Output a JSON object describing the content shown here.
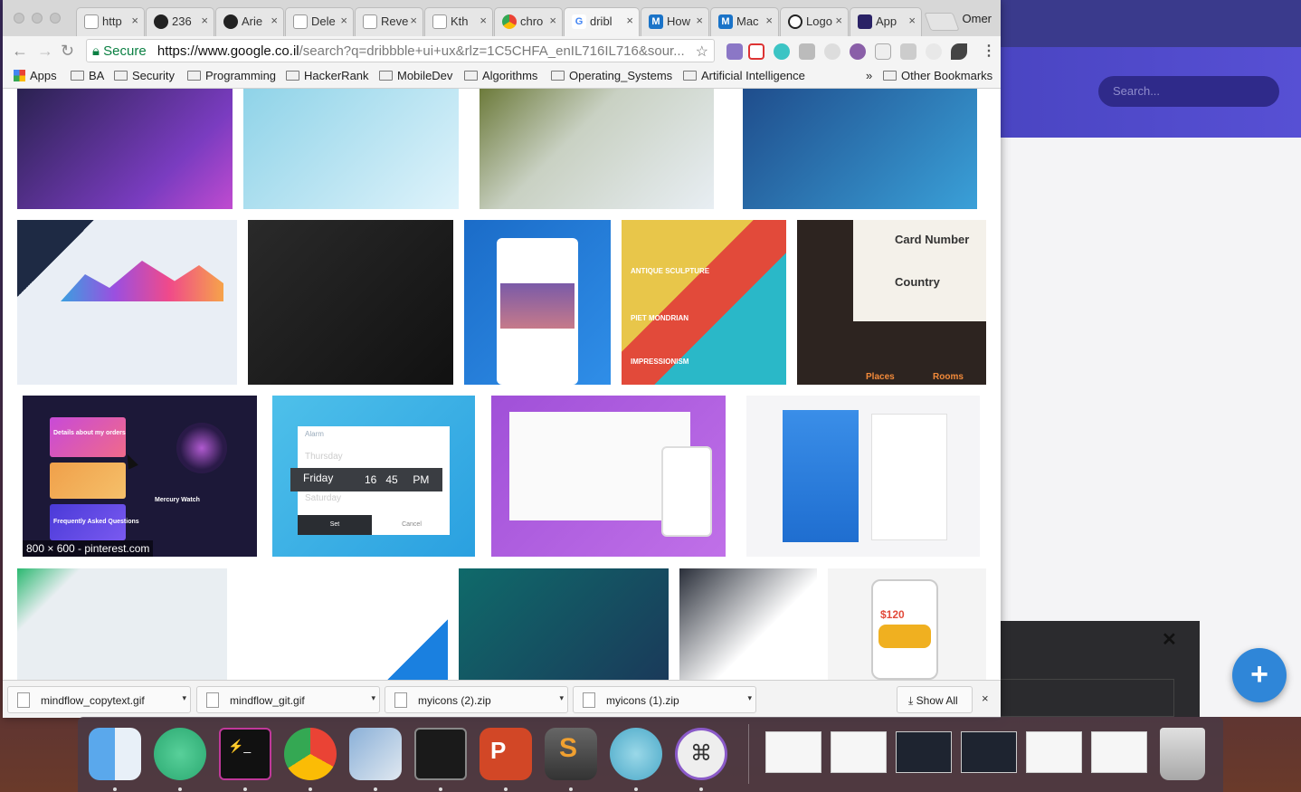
{
  "window": {
    "profile_name": "Omer",
    "tabs": [
      {
        "label": "http",
        "icon": "page-icon"
      },
      {
        "label": "236",
        "icon": "github-icon"
      },
      {
        "label": "Arie",
        "icon": "github-icon"
      },
      {
        "label": "Dele",
        "icon": "page-icon"
      },
      {
        "label": "Reve",
        "icon": "page-icon"
      },
      {
        "label": "Kth",
        "icon": "page-icon"
      },
      {
        "label": "chro",
        "icon": "chrome-icon"
      },
      {
        "label": "dribl",
        "icon": "google-icon"
      },
      {
        "label": "How",
        "icon": "medium-icon"
      },
      {
        "label": "Mac",
        "icon": "medium-icon"
      },
      {
        "label": "Logo",
        "icon": "circle-icon"
      },
      {
        "label": "App",
        "icon": "app-icon"
      }
    ],
    "active_tab_index": 7,
    "tab_close_glyph": "×"
  },
  "toolbar": {
    "secure_label": "Secure",
    "url_host": "https://www.google.co.il",
    "url_path": "/search?q=dribbble+ui+ux&rlz=1C5CHFA_enIL716IL716&sour..."
  },
  "bookmarks": {
    "items": [
      "Apps",
      "BA",
      "Security",
      "Programming",
      "HackerRank",
      "MobileDev",
      "Algorithms",
      "Operating_Systems",
      "Artificial Intelligence"
    ],
    "overflow": "»",
    "other": "Other Bookmarks"
  },
  "results": {
    "hover_caption": "800 × 600 - pinterest.com",
    "card_number": "Card Number",
    "country": "Country",
    "places": "Places",
    "rooms": "Rooms",
    "friday": "Friday",
    "friday_time": "16   45     PM",
    "set": "Set",
    "cancel": "Cancel",
    "alarm": "Alarm",
    "thursday": "Thursday",
    "saturday": "Saturday",
    "price": "$120",
    "piet": "PIET MONDRIAN",
    "antique": "ANTIQUE SCULPTURE",
    "impressionism": "IMPRESSIONISM",
    "mercury": "Mercury Watch",
    "details": "Details about my orders",
    "faq": "Frequently Asked Questions"
  },
  "downloads": {
    "files": [
      "mindflow_copytext.gif",
      "mindflow_git.gif",
      "myicons (2).zip",
      "myicons (1).zip"
    ],
    "show_all": "Show All",
    "close": "×"
  },
  "bg_app": {
    "search_placeholder": "Search...",
    "fab_label": "+",
    "close": "✕"
  },
  "dock": {
    "apps": [
      "finder-icon",
      "atom-icon",
      "terminal-icon",
      "chrome-icon",
      "preview-icon",
      "activity-monitor-icon",
      "powerpoint-icon",
      "sublime-icon",
      "electron-icon",
      "keyboard-icon",
      "trash-icon"
    ]
  },
  "colors": {
    "secure_green": "#0b8043",
    "bg_header": "#4a45c2",
    "fab_blue": "#2f86d8"
  }
}
